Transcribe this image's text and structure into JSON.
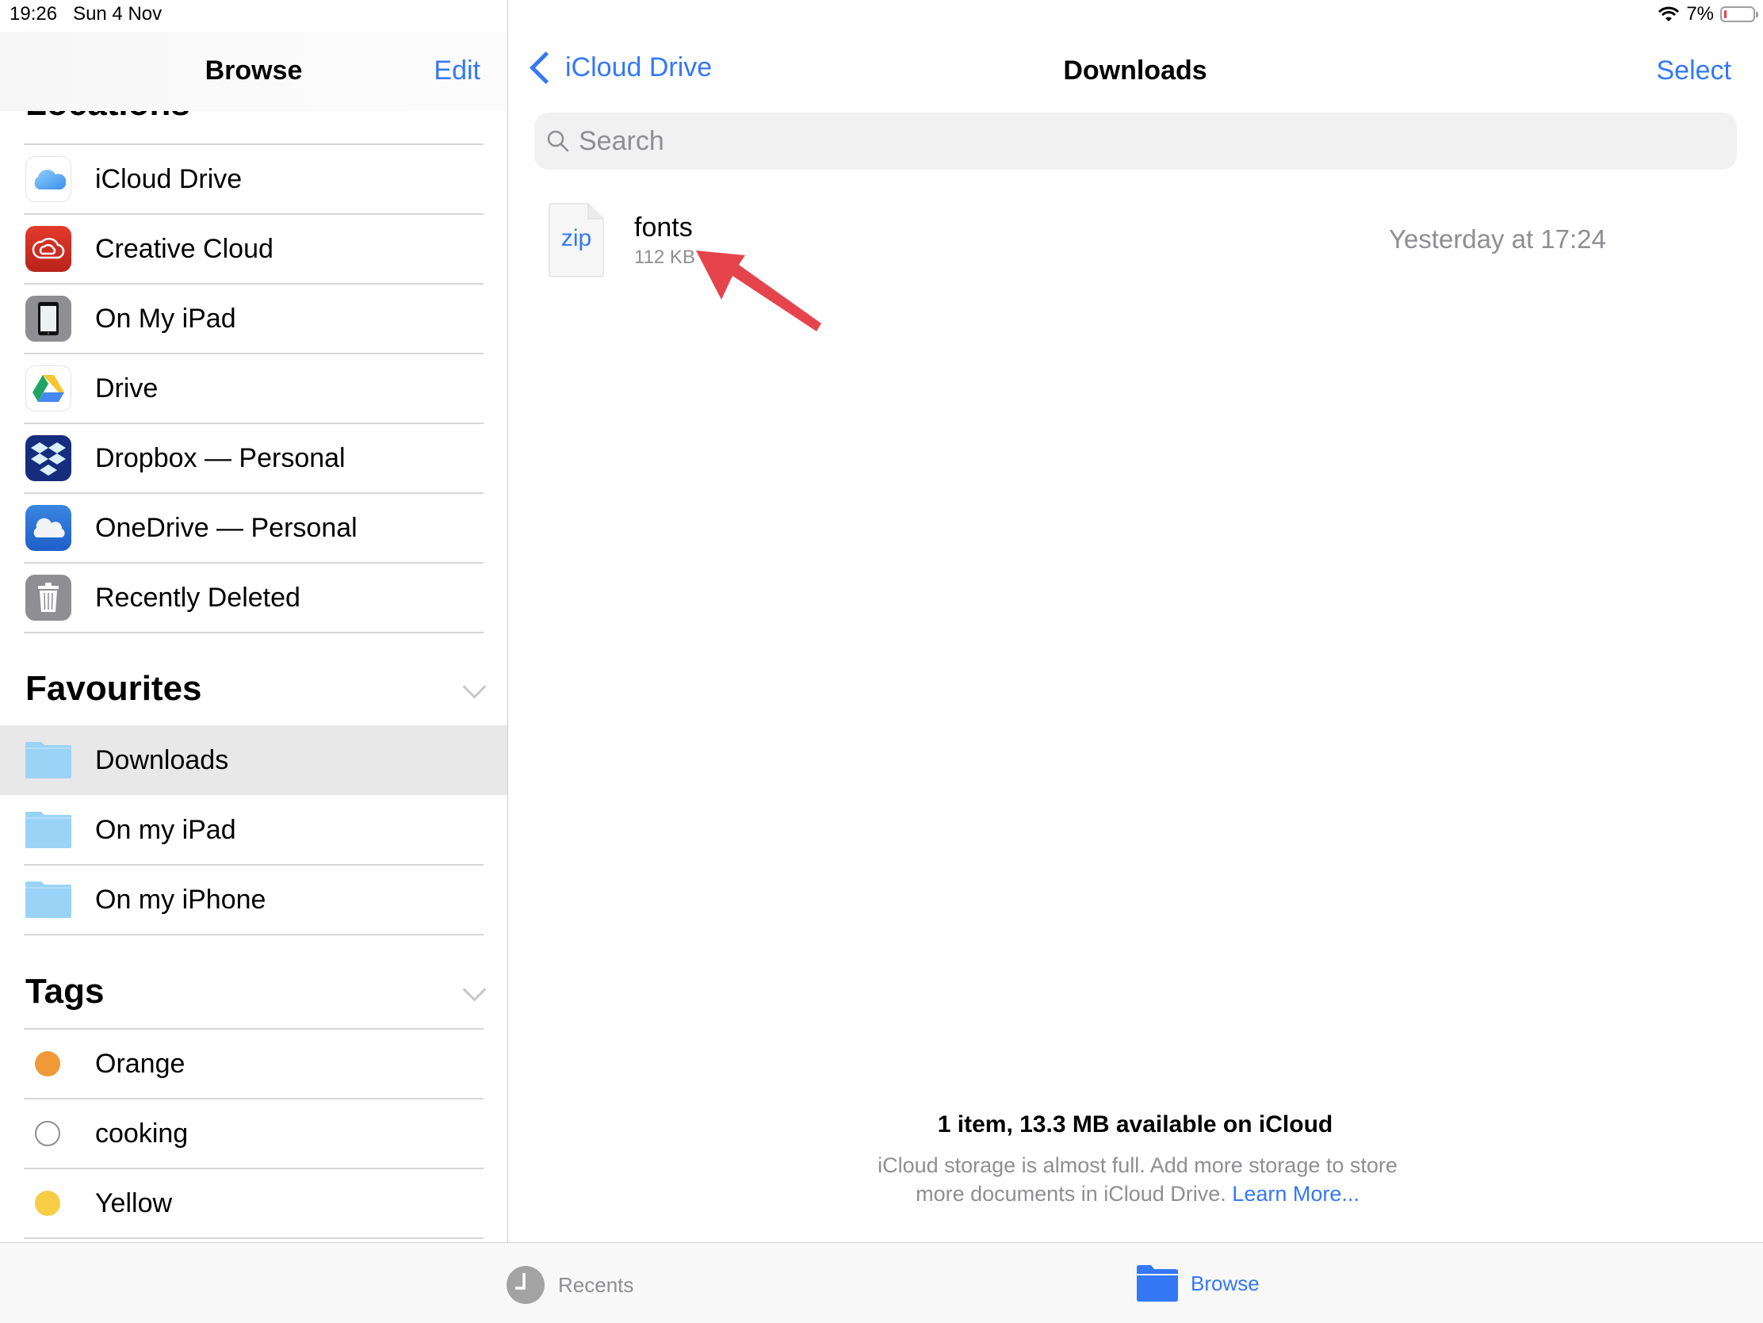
{
  "status_bar": {
    "time": "19:26",
    "date": "Sun 4 Nov",
    "battery_text": "7%",
    "battery_level": 0.07,
    "icons": [
      "wifi-icon",
      "battery-icon"
    ]
  },
  "sidebar": {
    "title": "Browse",
    "edit_label": "Edit",
    "locations_header": "Locations",
    "locations": [
      {
        "label": "iCloud Drive",
        "icon": "icloud-icon"
      },
      {
        "label": "Creative Cloud",
        "icon": "creative-cloud-icon"
      },
      {
        "label": "On My iPad",
        "icon": "ipad-icon"
      },
      {
        "label": "Drive",
        "icon": "google-drive-icon"
      },
      {
        "label": "Dropbox — Personal",
        "icon": "dropbox-icon"
      },
      {
        "label": "OneDrive — Personal",
        "icon": "onedrive-icon"
      },
      {
        "label": "Recently Deleted",
        "icon": "trash-icon"
      }
    ],
    "favourites_header": "Favourites",
    "favourites": [
      {
        "label": "Downloads",
        "icon": "folder-icon",
        "selected": true
      },
      {
        "label": "On my iPad",
        "icon": "folder-icon",
        "selected": false
      },
      {
        "label": "On my iPhone",
        "icon": "folder-icon",
        "selected": false
      }
    ],
    "tags_header": "Tags",
    "tags": [
      {
        "label": "Orange",
        "color": "#f09a37"
      },
      {
        "label": "cooking",
        "color": "none"
      },
      {
        "label": "Yellow",
        "color": "#f7cd46"
      }
    ]
  },
  "main": {
    "back_label": "iCloud Drive",
    "title": "Downloads",
    "select_label": "Select",
    "search_placeholder": "Search",
    "files": [
      {
        "name": "fonts",
        "type_label": "zip",
        "size": "112 KB",
        "modified": "Yesterday at 17:24"
      }
    ],
    "footer_title": "1 item, 13.3 MB available on iCloud",
    "footer_message": "iCloud storage is almost full. Add more storage to store more documents in iCloud Drive.",
    "footer_link": "Learn More..."
  },
  "annotation": {
    "type": "arrow",
    "color": "#e5444c",
    "points_to": "fonts file size"
  },
  "tab_bar": {
    "tabs": [
      {
        "label": "Recents",
        "icon": "clock-icon",
        "active": false
      },
      {
        "label": "Browse",
        "icon": "folder-icon",
        "active": true
      }
    ]
  },
  "colors": {
    "accent": "#3478f6",
    "secondary_text": "#8e8e93",
    "selected_row": "#e8e8e8"
  }
}
